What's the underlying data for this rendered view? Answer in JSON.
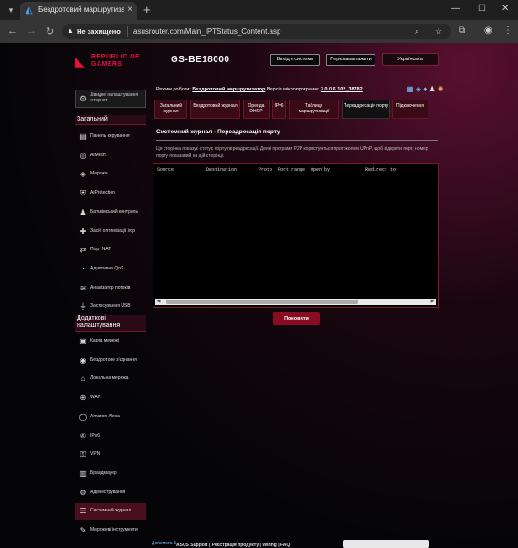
{
  "browser": {
    "tab_title": "Бездротовий маршрутизатор А",
    "new_tab": "+",
    "security_label": "Не захищено",
    "url": "asusrouter.com/Main_IPTStatus_Content.asp"
  },
  "header": {
    "brand_line1": "REPUBLIC OF",
    "brand_line2": "GAMERS",
    "model": "GS-BE18000",
    "logout": "Вихід з системи",
    "reboot": "Перезавантажити",
    "language": "Українська"
  },
  "status": {
    "mode_label": "Режим роботи:",
    "mode_value": "Бездротовий маршрутизатор",
    "fw_label": "Версія мікропрограми:",
    "fw_value": "3.0.0.6.102_38782"
  },
  "sidebar": {
    "quick_setup": "Швидке налаштування Інтернет",
    "general_heading": "Загальний",
    "general": [
      {
        "label": "Панель керування",
        "icon": "dashboard-icon"
      },
      {
        "label": "AiMesh",
        "icon": "aimesh-icon"
      },
      {
        "label": "Мережа",
        "icon": "network-icon"
      },
      {
        "label": "AiProtection",
        "icon": "shield-icon"
      },
      {
        "label": "Батьківський контроль",
        "icon": "parental-icon"
      },
      {
        "label": "Засіб оптимізації ігор",
        "icon": "game-icon"
      },
      {
        "label": "Порт NAT",
        "icon": "nat-icon"
      },
      {
        "label": "Адаптивна QoS",
        "icon": "qos-icon"
      },
      {
        "label": "Аналізатор потоків",
        "icon": "traffic-icon"
      },
      {
        "label": "Застосування USB",
        "icon": "usb-icon"
      }
    ],
    "advanced_heading": "Додаткові налаштування",
    "advanced": [
      {
        "label": "Карта мережі",
        "icon": "map-icon"
      },
      {
        "label": "Бездротове з'єднання",
        "icon": "wifi-icon"
      },
      {
        "label": "Локальна мережа",
        "icon": "lan-icon"
      },
      {
        "label": "WAN",
        "icon": "globe-icon"
      },
      {
        "label": "Amazon Alexa",
        "icon": "alexa-icon"
      },
      {
        "label": "IPv6",
        "icon": "ipv6-icon"
      },
      {
        "label": "VPN",
        "icon": "vpn-icon"
      },
      {
        "label": "Брандмауер",
        "icon": "firewall-icon"
      },
      {
        "label": "Адміністрування",
        "icon": "admin-icon"
      },
      {
        "label": "Системний журнал",
        "icon": "log-icon"
      },
      {
        "label": "Мережеві інструменти",
        "icon": "tools-icon"
      }
    ]
  },
  "tabs": [
    "Загальний журнал",
    "Бездротовий журнал",
    "Оренда DHCP",
    "IPv6",
    "Таблиця маршрутизації",
    "Переадресація порту",
    "Підключення"
  ],
  "panel": {
    "title": "Системний журнал - Переадресація порту",
    "description": "Ця сторінка показує статус порту переадресації. Деякі програми P2P користуються протоколом UPnP, щоб відкрити порт, номер порту показаний на цій сторінці.",
    "columns": "Source            Destination        Proto  Port range  Open by             Redirect to",
    "refresh": "Поновити"
  },
  "footer": {
    "help": "Допомога &",
    "links": "ASUS Support  |  Реєстрація продукту  |  Wiring  |  FAQ"
  }
}
